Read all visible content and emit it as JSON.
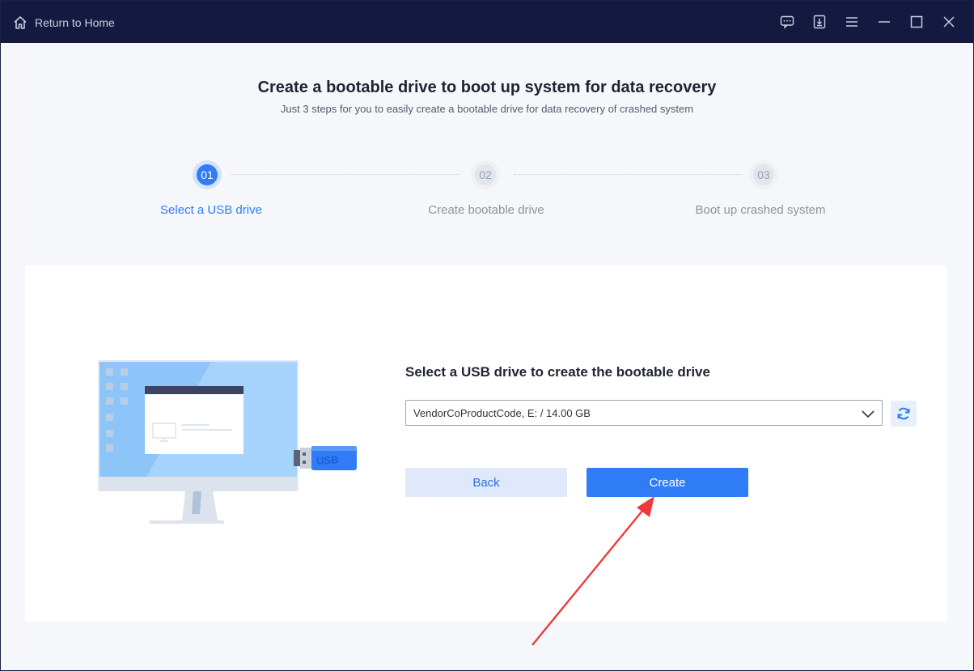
{
  "titlebar": {
    "home_label": "Return to Home",
    "icons": [
      "feedback-icon",
      "download-icon",
      "menu-icon",
      "minimize-icon",
      "maximize-icon",
      "close-icon"
    ]
  },
  "header": {
    "title": "Create a bootable drive to boot up system for data recovery",
    "subtitle": "Just 3 steps for you to easily create a bootable drive for data recovery of crashed system"
  },
  "steps": [
    {
      "number": "01",
      "label": "Select a USB drive",
      "active": true
    },
    {
      "number": "02",
      "label": "Create bootable drive",
      "active": false
    },
    {
      "number": "03",
      "label": "Boot up crashed system",
      "active": false
    }
  ],
  "main": {
    "prompt": "Select a USB drive to create the bootable drive",
    "drive_selected": "VendorCoProductCode, E: / 14.00 GB",
    "usb_label": "USB",
    "back_label": "Back",
    "create_label": "Create"
  },
  "colors": {
    "titlebar": "#141a3f",
    "accent": "#2f7cf6",
    "annotation_arrow": "#f03a3a"
  }
}
